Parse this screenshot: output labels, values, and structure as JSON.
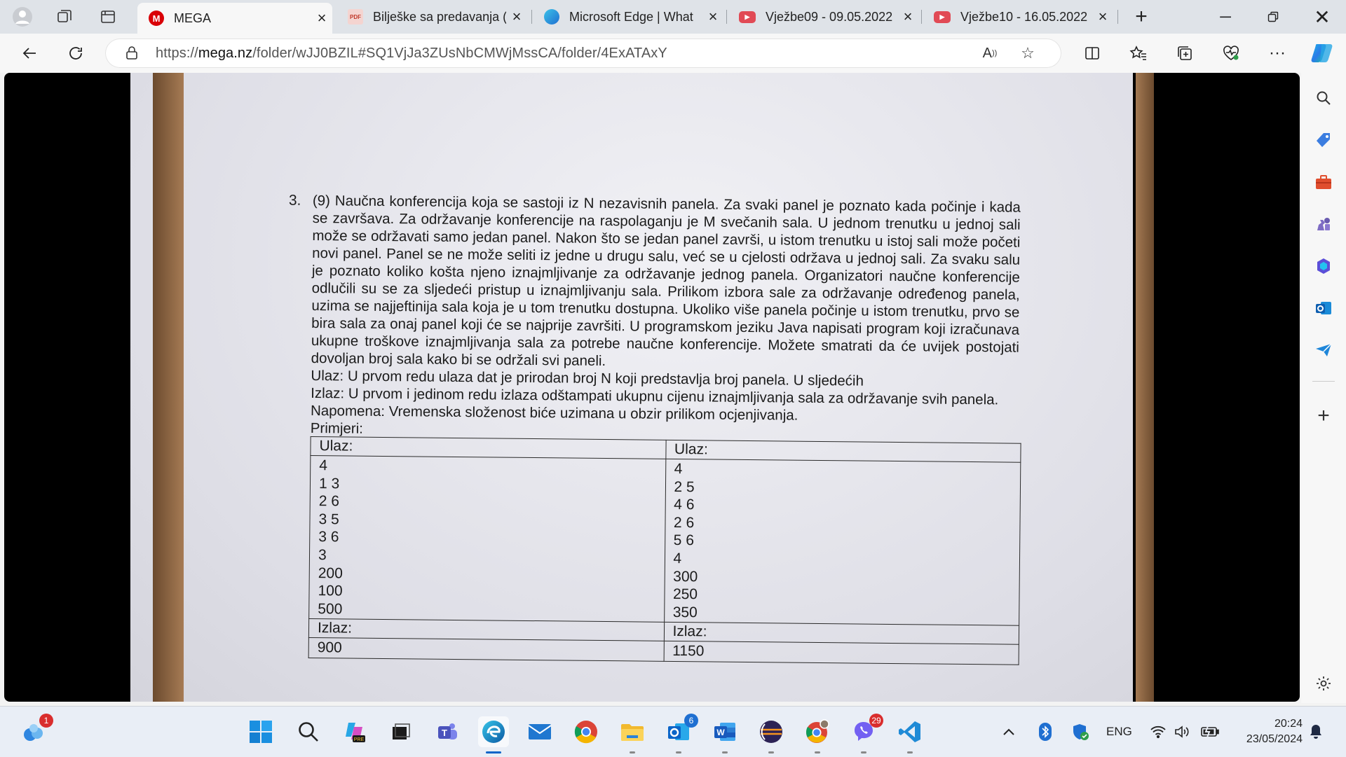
{
  "browser": {
    "tabs": [
      {
        "title": "MEGA",
        "favicon": "mega-icon",
        "color": "#d90007",
        "active": true
      },
      {
        "title": "Bilješke sa predavanja (",
        "favicon": "pdf-icon",
        "color": "#d44b3f",
        "active": false
      },
      {
        "title": "Microsoft Edge | What",
        "favicon": "edge-icon",
        "color": "#2b8fd9",
        "active": false
      },
      {
        "title": "Vježbe09 - 09.05.2022",
        "favicon": "youtube-icon",
        "color": "#e14a55",
        "active": false
      },
      {
        "title": "Vježbe10 - 16.05.2022",
        "favicon": "youtube-icon",
        "color": "#e14a55",
        "active": false
      }
    ],
    "url_prefix": "https://",
    "url_host": "mega.nz",
    "url_path": "/folder/wJJ0BZIL#SQ1VjJa3ZUsNbCMWjMssCA/folder/4ExATAxY"
  },
  "document": {
    "number": "3.",
    "text": "(9) Naučna konferencija koja se sastoji iz N nezavisnih panela. Za svaki panel je poznato kada počinje i kada se završava. Za održavanje konferencije na raspolaganju je M svečanih sala. U jednom trenutku u jednoj sali može se održavati samo jedan panel. Nakon što se jedan panel završi, u istom trenutku u istoj sali može početi novi panel. Panel se ne može seliti iz jedne u drugu salu, već se u cjelosti održava u jednoj sali. Za svaku salu je poznato koliko košta njeno iznajmljivanje za održavanje jednog panela. Organizatori naučne konferencije odlučili su se za sljedeći pristup u iznajmljivanju sala. Prilikom izbora sale za održavanje određenog panela, uzima se najjeftinija sala koja je u tom trenutku dostupna. Ukoliko više panela počinje u istom trenutku, prvo se bira sala za onaj panel koji će se najprije završiti. U programskom jeziku Java napisati program koji izračunava ukupne troškove iznajmljivanja sala za potrebe naučne konferencije. Možete smatrati da će uvijek postojati dovoljan broj sala kako bi se održali svi paneli.",
    "input_desc": "Ulaz: U prvom redu ulaza dat je prirodan broj N koji predstavlja broj panela. U sljedećih",
    "output_desc": "Izlaz: U prvom i jedinom redu izlaza odštampati ukupnu cijenu iznajmljivanja sala za održavanje svih panela.",
    "note": "Napomena: Vremenska složenost biće uzimana u obzir prilikom ocjenjivanja.",
    "examples_label": "Primjeri:",
    "examples": [
      {
        "input_label": "Ulaz:",
        "input_lines": [
          "4",
          "1 3",
          "2 6",
          "3 5",
          "3 6",
          "3",
          "200",
          "100",
          "500"
        ],
        "output_label": "Izlaz:",
        "output": "900"
      },
      {
        "input_label": "Ulaz:",
        "input_lines": [
          "4",
          "2 5",
          "4 6",
          "2 6",
          "5 6",
          "4",
          "300",
          "250",
          "350"
        ],
        "output_label": "Izlaz:",
        "output": "1150"
      }
    ]
  },
  "taskbar": {
    "badges": {
      "copilot": "1",
      "outlook": "6",
      "viber": "29"
    },
    "language": "ENG",
    "time": "20:24",
    "date": "23/05/2024"
  }
}
